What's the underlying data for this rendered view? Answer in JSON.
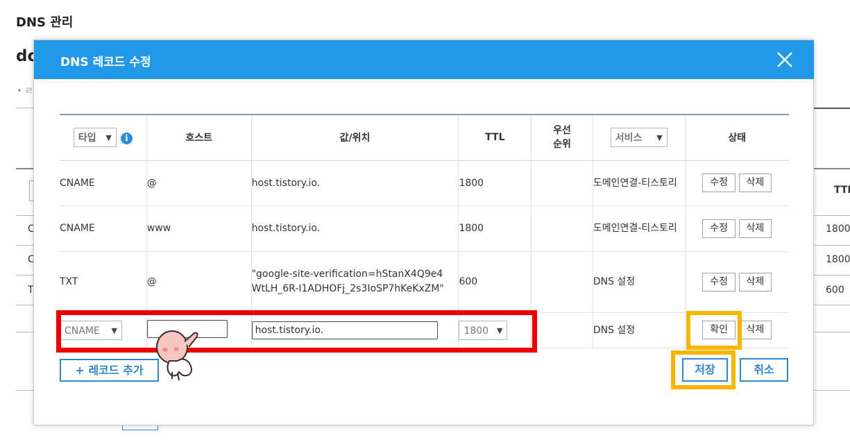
{
  "page": {
    "title": "DNS 관리",
    "domain_fragment": "do",
    "bullet_fragment": "• ㄹ",
    "bg_header_ttl": "TTL",
    "bg_rows": [
      {
        "type_fragment": "C",
        "ttl": "1800"
      },
      {
        "type_fragment": "C",
        "ttl": "1800"
      },
      {
        "type_fragment": "T",
        "ttl": "600"
      }
    ]
  },
  "modal": {
    "title": "DNS 레코드 수정",
    "close_icon": "close-icon",
    "header_color": "#2299e6",
    "columns": {
      "type_select": "타입",
      "host": "호스트",
      "value": "값/위치",
      "ttl": "TTL",
      "priority": "우선\n순위",
      "service_select": "서비스",
      "status": "상태"
    },
    "records": [
      {
        "type": "CNAME",
        "host": "@",
        "value": "host.tistory.io.",
        "ttl": "1800",
        "priority": "",
        "service": "도메인연결-티스토리",
        "edit": "수정",
        "delete": "삭제"
      },
      {
        "type": "CNAME",
        "host": "www",
        "value": "host.tistory.io.",
        "ttl": "1800",
        "priority": "",
        "service": "도메인연결-티스토리",
        "edit": "수정",
        "delete": "삭제"
      },
      {
        "type": "TXT",
        "host": "@",
        "value": "\"google-site-verification=hStanX4Q9e4WtLH_6R-I1ADHOFj_2s3IoSP7hKeKxZM\"",
        "ttl": "600",
        "priority": "",
        "service": "DNS 설정",
        "edit": "수정",
        "delete": "삭제"
      }
    ],
    "edit_row": {
      "type": "CNAME",
      "host": "",
      "value": "host.tistory.io.",
      "ttl": "1800",
      "service": "DNS 설정",
      "confirm": "확인",
      "delete": "삭제"
    },
    "add_record": "+ 레코드 추가",
    "save": "저장",
    "cancel": "취소"
  },
  "colors": {
    "accent": "#2e86cf",
    "highlight_red": "#ee0000",
    "highlight_yellow": "#f7b700"
  }
}
